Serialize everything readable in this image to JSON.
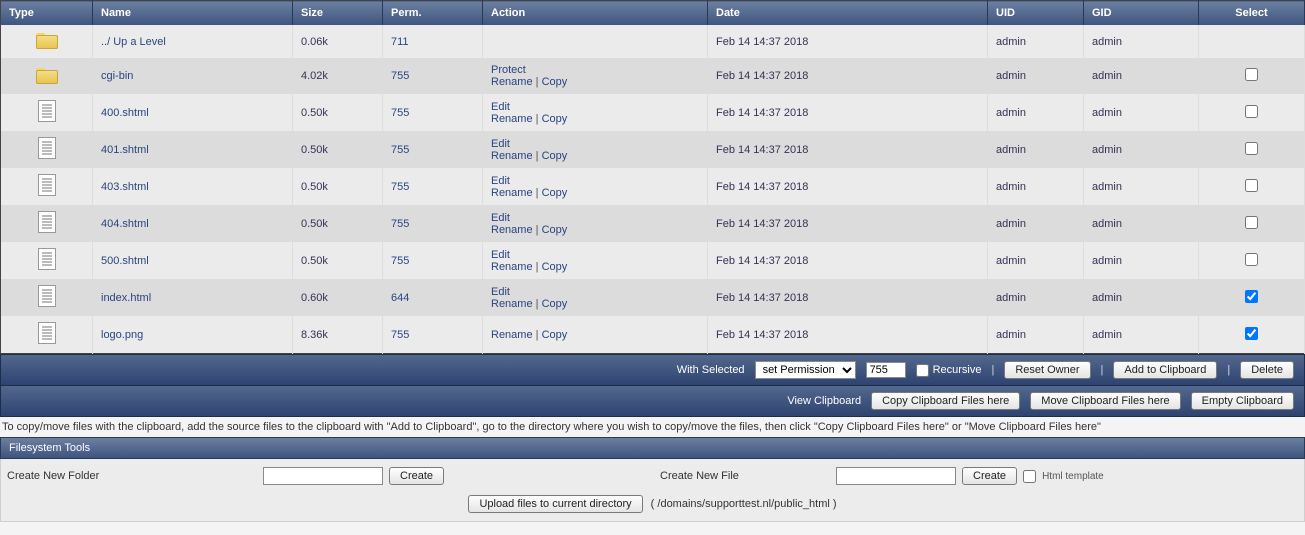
{
  "headers": {
    "type": "Type",
    "name": "Name",
    "size": "Size",
    "perm": "Perm.",
    "action": "Action",
    "date": "Date",
    "uid": "UID",
    "gid": "GID",
    "select": "Select"
  },
  "rows": [
    {
      "icon": "folder",
      "name": "../ Up a Level",
      "size": "0.06k",
      "perm": "711",
      "actions": [],
      "date": "Feb 14 14:37 2018",
      "uid": "admin",
      "gid": "admin",
      "select": null
    },
    {
      "icon": "folder",
      "name": "cgi-bin",
      "size": "4.02k",
      "perm": "755",
      "actions": [
        "Protect",
        "Rename",
        "Copy"
      ],
      "date": "Feb 14 14:37 2018",
      "uid": "admin",
      "gid": "admin",
      "select": false
    },
    {
      "icon": "file",
      "name": "400.shtml",
      "size": "0.50k",
      "perm": "755",
      "actions": [
        "Edit",
        "Rename",
        "Copy"
      ],
      "date": "Feb 14 14:37 2018",
      "uid": "admin",
      "gid": "admin",
      "select": false
    },
    {
      "icon": "file",
      "name": "401.shtml",
      "size": "0.50k",
      "perm": "755",
      "actions": [
        "Edit",
        "Rename",
        "Copy"
      ],
      "date": "Feb 14 14:37 2018",
      "uid": "admin",
      "gid": "admin",
      "select": false
    },
    {
      "icon": "file",
      "name": "403.shtml",
      "size": "0.50k",
      "perm": "755",
      "actions": [
        "Edit",
        "Rename",
        "Copy"
      ],
      "date": "Feb 14 14:37 2018",
      "uid": "admin",
      "gid": "admin",
      "select": false
    },
    {
      "icon": "file",
      "name": "404.shtml",
      "size": "0.50k",
      "perm": "755",
      "actions": [
        "Edit",
        "Rename",
        "Copy"
      ],
      "date": "Feb 14 14:37 2018",
      "uid": "admin",
      "gid": "admin",
      "select": false
    },
    {
      "icon": "file",
      "name": "500.shtml",
      "size": "0.50k",
      "perm": "755",
      "actions": [
        "Edit",
        "Rename",
        "Copy"
      ],
      "date": "Feb 14 14:37 2018",
      "uid": "admin",
      "gid": "admin",
      "select": false
    },
    {
      "icon": "file",
      "name": "index.html",
      "size": "0.60k",
      "perm": "644",
      "actions": [
        "Edit",
        "Rename",
        "Copy"
      ],
      "date": "Feb 14 14:37 2018",
      "uid": "admin",
      "gid": "admin",
      "select": true
    },
    {
      "icon": "file",
      "name": "logo.png",
      "size": "8.36k",
      "perm": "755",
      "actions": [
        "Rename",
        "Copy"
      ],
      "date": "Feb 14 14:37 2018",
      "uid": "admin",
      "gid": "admin",
      "select": true
    }
  ],
  "withSelected": {
    "label": "With Selected",
    "setPermission": "set Permission",
    "permValue": "755",
    "recursive": "Recursive",
    "resetOwner": "Reset Owner",
    "addToClipboard": "Add to Clipboard",
    "delete": "Delete"
  },
  "clipboardBar": {
    "viewClipboard": "View Clipboard",
    "copyHere": "Copy Clipboard Files here",
    "moveHere": "Move Clipboard Files here",
    "empty": "Empty Clipboard"
  },
  "helpText": "To copy/move files with the clipboard, add the source files to the clipboard with \"Add to Clipboard\", go to the directory where you wish to copy/move the files, then click \"Copy Clipboard Files here\" or \"Move Clipboard Files here\"",
  "toolsHeader": "Filesystem Tools",
  "tools": {
    "createFolderLabel": "Create New Folder",
    "createFileLabel": "Create New File",
    "createBtn": "Create",
    "htmlTemplate": "Html template",
    "uploadBtn": "Upload files to current directory",
    "currentPath": "( /domains/supporttest.nl/public_html )"
  }
}
